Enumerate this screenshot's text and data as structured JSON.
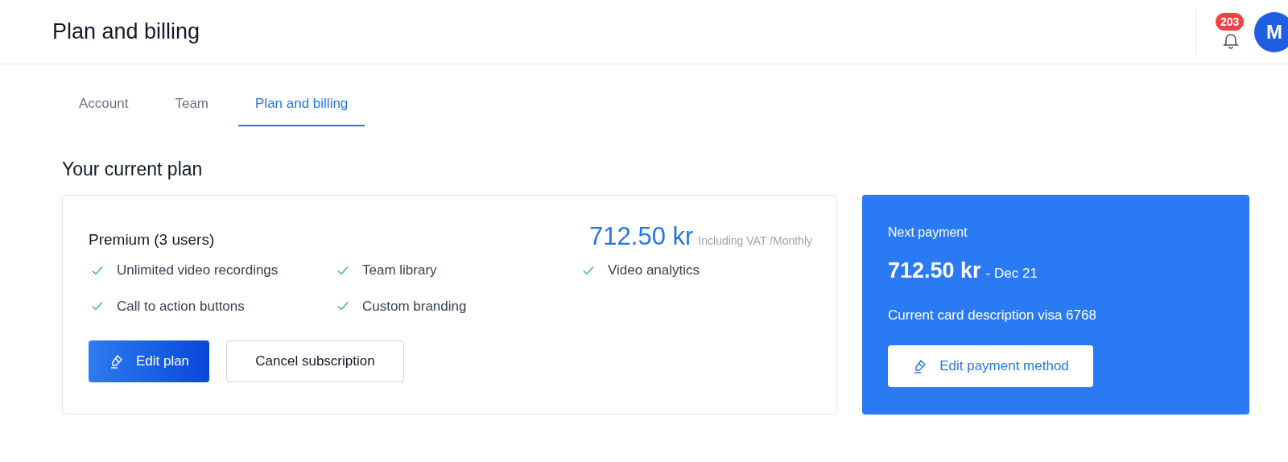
{
  "header": {
    "title": "Plan and billing",
    "notification_count": "203",
    "avatar_initial": "M"
  },
  "tabs": [
    {
      "label": "Account",
      "selected": false
    },
    {
      "label": "Team",
      "selected": false
    },
    {
      "label": "Plan and billing",
      "selected": true
    }
  ],
  "section_title": "Your current plan",
  "plan": {
    "name": "Premium (3 users)",
    "price": "712.50 kr",
    "price_note": "Including VAT /Monthly",
    "features": [
      "Unlimited video recordings",
      "Team library",
      "Video analytics",
      "Call to action buttons",
      "Custom branding"
    ],
    "edit_button": "Edit plan",
    "cancel_button": "Cancel subscription"
  },
  "payment": {
    "title": "Next payment",
    "amount": "712.50 kr",
    "date": "- Dec 21",
    "card": "Current card description visa 6768",
    "edit_button": "Edit payment method"
  }
}
